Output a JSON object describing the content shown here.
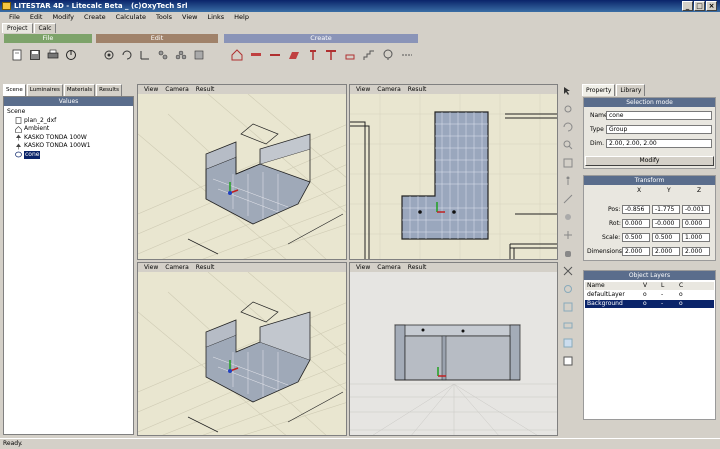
{
  "window": {
    "title": "LITESTAR 4D - Litecalc Beta _ (c)OxyTech Srl",
    "minimize": "_",
    "maximize": "□",
    "close": "×"
  },
  "menu": [
    "File",
    "Edit",
    "Modify",
    "Create",
    "Calculate",
    "Tools",
    "View",
    "Links",
    "Help"
  ],
  "project_tabs": [
    "Project",
    "Calc"
  ],
  "ribbon": {
    "groups": [
      {
        "label": "File",
        "color": "#7da36a",
        "icons": [
          "open-file-icon",
          "save-file-icon",
          "print-icon",
          "exit-icon"
        ]
      },
      {
        "label": "Edit",
        "color": "#a0826a",
        "icons": [
          "move-icon",
          "rotate-icon",
          "scale-icon",
          "copy-icon",
          "array-icon",
          "delete-icon"
        ]
      },
      {
        "label": "Create",
        "color": "#8a94b8",
        "icons": [
          "room-icon",
          "luminaire-icon",
          "wall-icon",
          "floor-icon",
          "pole-icon",
          "pole-double-icon",
          "furniture-icon",
          "stairs-icon",
          "tree-icon",
          "path-icon"
        ]
      }
    ]
  },
  "left_panel": {
    "tabs": [
      "Scene",
      "Luminaires",
      "Materials",
      "Results"
    ],
    "active_tab": "Scene",
    "header": "Values",
    "tree": {
      "root": "Scene",
      "items": [
        {
          "label": "plan_2_dxf",
          "icon": "file-icon"
        },
        {
          "label": "Ambient",
          "icon": "house-icon"
        },
        {
          "label": "KASKO TONDA 100W",
          "icon": "lamp-icon"
        },
        {
          "label": "KASKO TONDA 100W1",
          "icon": "lamp-icon"
        },
        {
          "label": "cone",
          "icon": "cone-icon",
          "selected": true
        }
      ]
    }
  },
  "viewports": [
    {
      "menus": [
        "View",
        "Camera",
        "Result"
      ],
      "kind": "perspective"
    },
    {
      "menus": [
        "View",
        "Camera",
        "Result"
      ],
      "kind": "top"
    },
    {
      "menus": [
        "View",
        "Camera",
        "Result"
      ],
      "kind": "perspective"
    },
    {
      "menus": [
        "View",
        "Camera",
        "Result"
      ],
      "kind": "front"
    }
  ],
  "right_panel": {
    "tabs": [
      "Property",
      "Library"
    ],
    "active_tab": "Property",
    "selection": {
      "header": "Selection mode",
      "name_label": "Name",
      "name_value": "cone",
      "type_label": "Type",
      "type_value": "Group",
      "dim_label": "Dim.",
      "dim_value": "2.00, 2.00, 2.00",
      "modify_button": "Modify"
    },
    "transform": {
      "header": "Transform",
      "columns": [
        "X",
        "Y",
        "Z"
      ],
      "rows": [
        {
          "label": "Pos:",
          "values": [
            "-0.856",
            "-1.775",
            "-0.001"
          ]
        },
        {
          "label": "Rot:",
          "values": [
            "0.000",
            "-0.000",
            "0.000"
          ]
        },
        {
          "label": "Scale:",
          "values": [
            "0.500",
            "0.500",
            "1.000"
          ]
        },
        {
          "label": "Dimensions:",
          "values": [
            "2.000",
            "2.000",
            "2.000"
          ]
        }
      ]
    },
    "layers": {
      "header": "Object Layers",
      "columns": [
        "Name",
        "V",
        "L",
        "C"
      ],
      "rows": [
        {
          "name": "defaultLayer",
          "v": "o",
          "l": "-",
          "c": "o",
          "selected": false
        },
        {
          "name": "Background",
          "v": "o",
          "l": "-",
          "c": "o",
          "selected": true
        }
      ]
    }
  },
  "status": "Ready."
}
